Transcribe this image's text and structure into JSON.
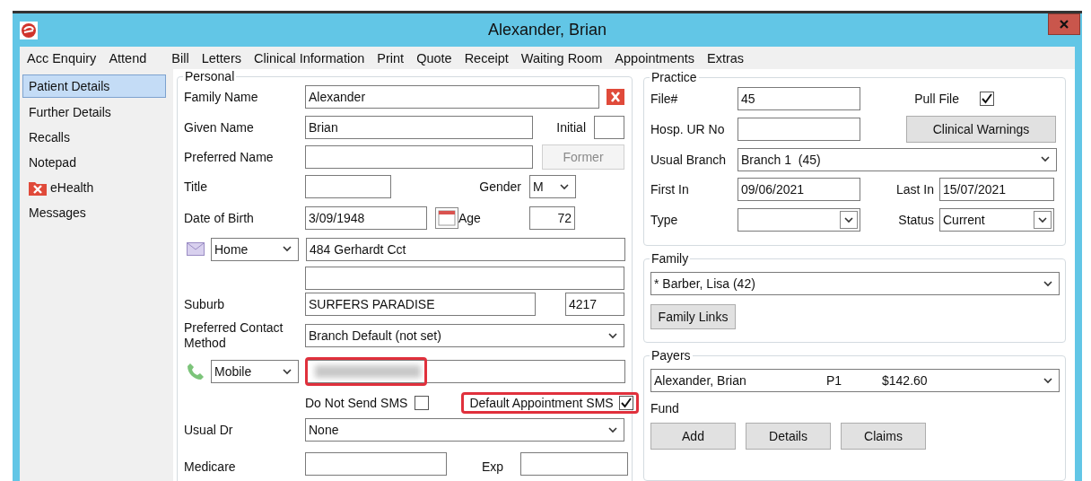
{
  "window": {
    "title": "Alexander, Brian"
  },
  "menu": [
    "Acc Enquiry",
    "Attend",
    "Bill",
    "Letters",
    "Clinical Information",
    "Print",
    "Quote",
    "Receipt",
    "Waiting Room",
    "Appointments",
    "Extras"
  ],
  "sidebar": [
    {
      "label": "Patient Details",
      "selected": true,
      "kind": "plain"
    },
    {
      "label": "Further Details",
      "selected": false,
      "kind": "plain"
    },
    {
      "label": "Recalls",
      "selected": false,
      "kind": "plain"
    },
    {
      "label": "Notepad",
      "selected": false,
      "kind": "plain"
    },
    {
      "label": "eHealth",
      "selected": false,
      "kind": "flagged"
    },
    {
      "label": "Messages",
      "selected": false,
      "kind": "plain"
    }
  ],
  "personal": {
    "title": "Personal",
    "family_name": {
      "label": "Family Name",
      "value": "Alexander"
    },
    "given_name": {
      "label": "Given Name",
      "value": "Brian"
    },
    "initial": {
      "label": "Initial"
    },
    "preferred_name": {
      "label": "Preferred Name"
    },
    "former_button": {
      "label": "Former",
      "disabled": true
    },
    "title_field": {
      "label": "Title"
    },
    "gender": {
      "label": "Gender",
      "value": "M"
    },
    "dob": {
      "label": "Date of Birth",
      "value": "3/09/1948"
    },
    "age": {
      "label": "Age",
      "value": "72"
    },
    "address": {
      "type": "Home",
      "line1": "484 Gerhardt Cct"
    },
    "suburb": {
      "label": "Suburb",
      "value": "SURFERS PARADISE",
      "postcode": "4217"
    },
    "contact_method": {
      "label": "Preferred Contact Method",
      "value": "Branch Default (not set)"
    },
    "phone": {
      "type": "Mobile",
      "redacted": true,
      "highlighted": true
    },
    "do_not_send_sms": {
      "label": "Do Not Send SMS",
      "checked": false
    },
    "default_appointment_sms": {
      "label": "Default Appointment SMS",
      "checked": true,
      "highlighted": true
    },
    "usual_dr": {
      "label": "Usual Dr",
      "value": "None"
    },
    "medicare": {
      "label": "Medicare"
    },
    "exp": {
      "label": "Exp"
    }
  },
  "practice": {
    "title": "Practice",
    "file_no": {
      "label": "File#",
      "value": "45"
    },
    "pull_file": {
      "label": "Pull File",
      "checked": true
    },
    "hosp_ur": {
      "label": "Hosp. UR No"
    },
    "clinical_warnings_button": "Clinical Warnings",
    "usual_branch": {
      "label": "Usual Branch",
      "value": "Branch 1  (45)"
    },
    "first_in": {
      "label": "First In",
      "value": "09/06/2021"
    },
    "last_in": {
      "label": "Last In",
      "value": "15/07/2021"
    },
    "type": {
      "label": "Type"
    },
    "status": {
      "label": "Status",
      "value": "Current"
    }
  },
  "family": {
    "title": "Family",
    "member": "* Barber, Lisa (42)",
    "button": "Family Links"
  },
  "payers": {
    "title": "Payers",
    "payer": {
      "name": "Alexander, Brian",
      "code": "P1",
      "amount": "$142.60"
    },
    "fund_label": "Fund",
    "buttons": [
      "Add",
      "Details",
      "Claims"
    ]
  }
}
